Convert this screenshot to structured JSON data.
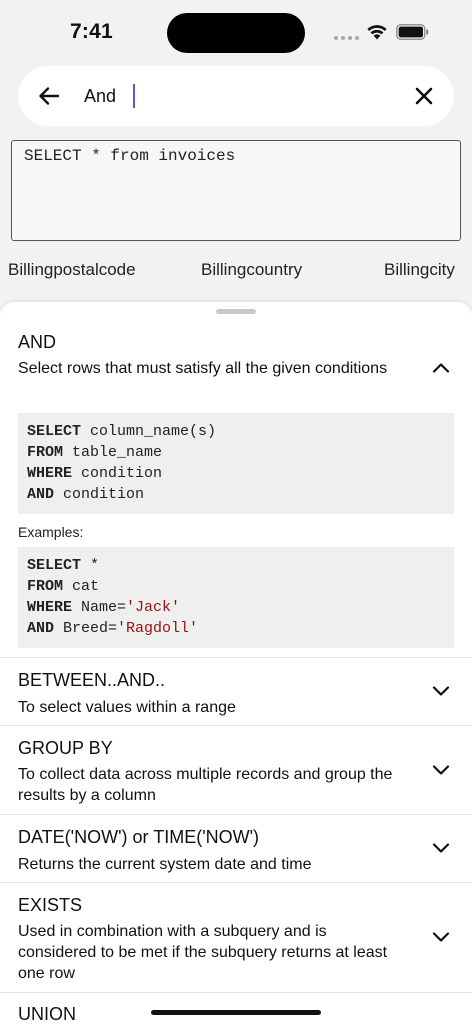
{
  "status_bar": {
    "time": "7:41"
  },
  "search": {
    "value": "And"
  },
  "editor": {
    "query": "SELECT * from invoices"
  },
  "columns": [
    "Billingpostalcode",
    "Billingcountry",
    "Billingcity"
  ],
  "expanded": {
    "title": "AND",
    "description": "Select rows that must satisfy all the given conditions",
    "syntax": [
      {
        "kw": "SELECT",
        "rest": " column_name(s)"
      },
      {
        "kw": "FROM",
        "rest": " table_name"
      },
      {
        "kw": "WHERE",
        "rest": " condition"
      },
      {
        "kw": "AND",
        "rest": " condition"
      }
    ],
    "examples_label": "Examples:",
    "example": [
      {
        "kw": "SELECT",
        "rest": " *",
        "str": ""
      },
      {
        "kw": "FROM",
        "rest": " cat",
        "str": ""
      },
      {
        "kw": "WHERE",
        "rest": " Name=",
        "str": "'Jack'"
      },
      {
        "kw": "AND",
        "rest": " Breed=",
        "str": "'Ragdoll'"
      }
    ]
  },
  "items": [
    {
      "title": "BETWEEN..AND..",
      "description": "To select values within a range"
    },
    {
      "title": "GROUP BY",
      "description": "To collect data across multiple records and group the results by a column"
    },
    {
      "title": "DATE('NOW') or TIME('NOW')",
      "description": "Returns the current system date and time"
    },
    {
      "title": "EXISTS",
      "description": "Used in combination with a subquery and is considered to be met if the subquery returns at least one row"
    },
    {
      "title": "UNION",
      "description": ""
    }
  ]
}
